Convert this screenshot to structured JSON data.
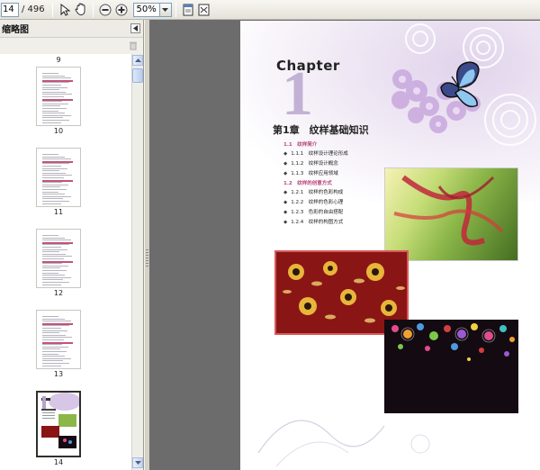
{
  "toolbar": {
    "page_current": "14",
    "page_total": "/ 496",
    "zoom_value": "50%",
    "icons": [
      "select-arrow-icon",
      "hand-tool-icon",
      "zoom-out-icon",
      "zoom-in-icon",
      "fit-page-icon",
      "fit-width-icon"
    ]
  },
  "sidebar": {
    "title": "缩略图",
    "thumbnails": [
      {
        "page": "9"
      },
      {
        "page": "10"
      },
      {
        "page": "11"
      },
      {
        "page": "12"
      },
      {
        "page": "13"
      },
      {
        "page": "14",
        "selected": true
      }
    ]
  },
  "document": {
    "chapter_label": "Chapter",
    "chapter_number": "1",
    "chapter_title": "第1章　纹样基础知识",
    "toc": [
      {
        "kind": "section",
        "text": "1.1　纹样简介"
      },
      {
        "kind": "item",
        "text": "1.1.1　纹样设计理论形成"
      },
      {
        "kind": "item",
        "text": "1.1.2　纹样设计概念"
      },
      {
        "kind": "item",
        "text": "1.1.3　纹样应用领域"
      },
      {
        "kind": "section",
        "text": "1.2　纹样的创意方式"
      },
      {
        "kind": "item",
        "text": "1.2.1　纹样的色彩构成"
      },
      {
        "kind": "item",
        "text": "1.2.2　纹样的色彩心理"
      },
      {
        "kind": "item",
        "text": "1.2.3　色彩的自由搭配"
      },
      {
        "kind": "item",
        "text": "1.2.4　纹样的构图方式"
      }
    ]
  },
  "colors": {
    "accent_pink": "#b8467a",
    "doc_background": "#6c6c6c",
    "chapter_purple": "#b7a2cd"
  }
}
